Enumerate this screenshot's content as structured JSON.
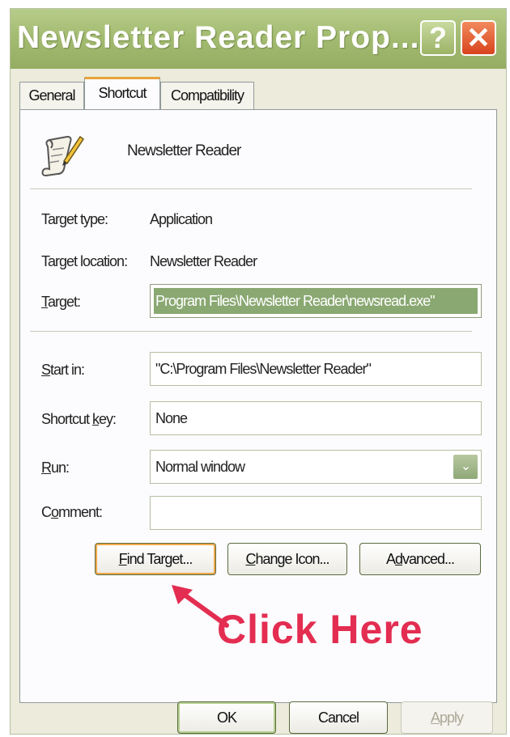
{
  "window": {
    "title": "Newsletter Reader Prop...",
    "help_glyph": "?",
    "close_glyph": "✕",
    "accent_color": "#a4bc72"
  },
  "tabs": [
    {
      "label": "General",
      "active": false
    },
    {
      "label": "Shortcut",
      "active": true
    },
    {
      "label": "Compatibility",
      "active": false
    }
  ],
  "header": {
    "icon": "scroll-with-pen-icon",
    "name": "Newsletter Reader"
  },
  "info": {
    "target_type_label": "Target type:",
    "target_type_value": "Application",
    "target_location_label": "Target location:",
    "target_location_value": "Newsletter Reader"
  },
  "fields": {
    "target": {
      "label_u": "T",
      "label_rest": "arget:",
      "value": "Program Files\\Newsletter Reader\\newsread.exe\""
    },
    "start_in": {
      "label_u": "S",
      "label_rest": "tart in:",
      "value": "\"C:\\Program Files\\Newsletter Reader\""
    },
    "shortcut_key": {
      "label_pre": "Shortcut ",
      "label_u": "k",
      "label_rest": "ey:",
      "value": "None"
    },
    "run": {
      "label_u": "R",
      "label_rest": "un:",
      "value": "Normal window",
      "arrow_glyph": "⌄"
    },
    "comment": {
      "label_pre": "C",
      "label_u": "o",
      "label_rest": "mment:",
      "value": ""
    }
  },
  "actions": {
    "find_target": {
      "u": "F",
      "rest": "ind Target..."
    },
    "change_icon": {
      "u": "C",
      "rest": "hange Icon..."
    },
    "advanced": {
      "pre": "A",
      "u": "d",
      "rest": "vanced..."
    }
  },
  "annotation": {
    "text": "Click Here",
    "color": "#e32d51"
  },
  "footer": {
    "ok": "OK",
    "cancel": "Cancel",
    "apply_u": "A",
    "apply_rest": "pply"
  }
}
